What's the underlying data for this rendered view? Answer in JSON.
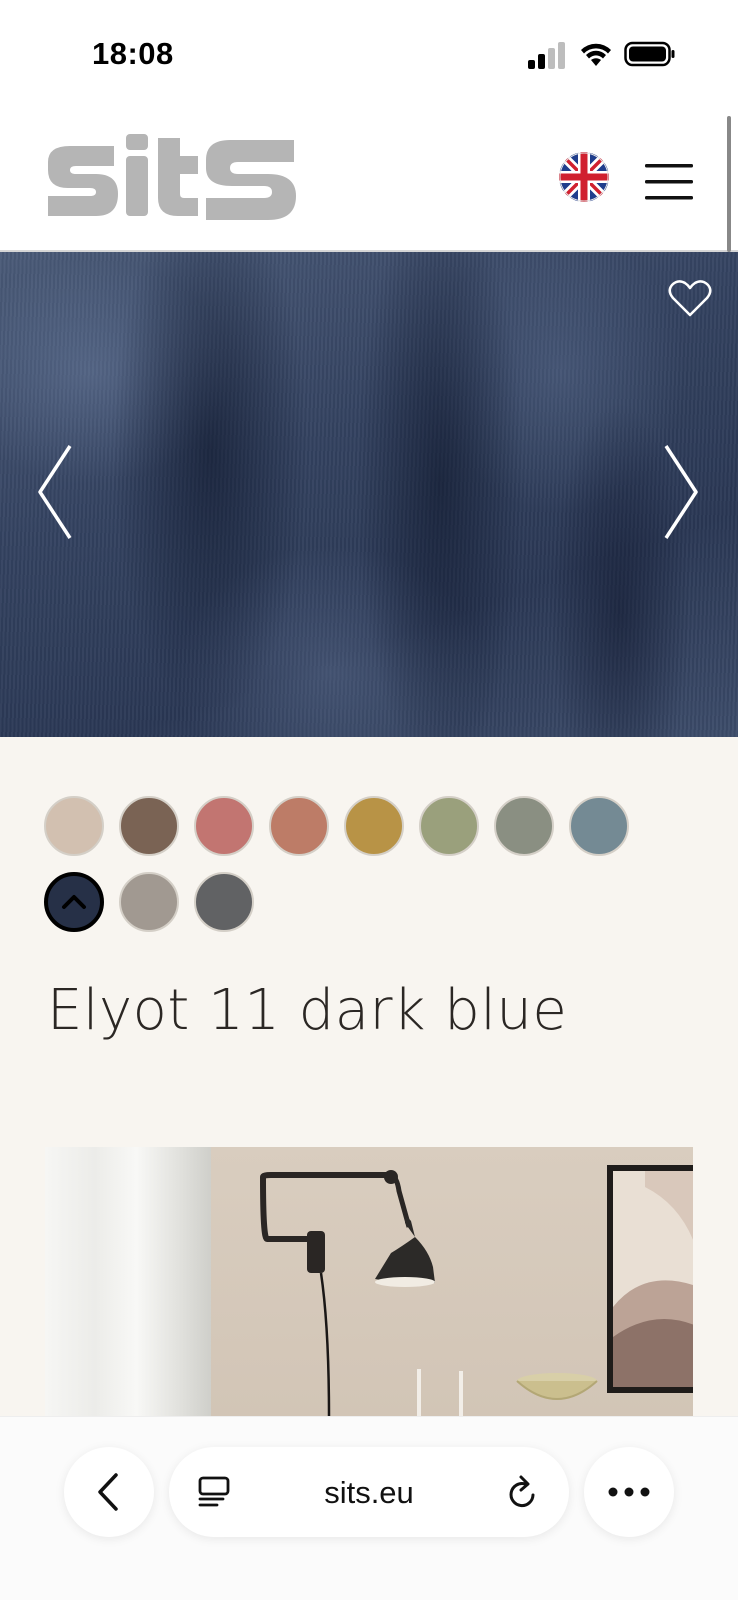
{
  "status_bar": {
    "time": "18:08"
  },
  "header": {
    "logo_text": "sits",
    "language_icon": "uk-flag-icon",
    "menu_icon": "hamburger-menu-icon"
  },
  "hero": {
    "favorite_icon": "heart-outline-icon",
    "prev_icon": "chevron-left-icon",
    "next_icon": "chevron-right-icon"
  },
  "swatches": [
    {
      "color": "#d2c0b0",
      "selected": false
    },
    {
      "color": "#7a6354",
      "selected": false
    },
    {
      "color": "#c27571",
      "selected": false
    },
    {
      "color": "#bd7c67",
      "selected": false
    },
    {
      "color": "#b89346",
      "selected": false
    },
    {
      "color": "#9aa07c",
      "selected": false
    },
    {
      "color": "#8a8f82",
      "selected": false
    },
    {
      "color": "#748a94",
      "selected": false
    },
    {
      "color": "#263047",
      "selected": true
    },
    {
      "color": "#a19991",
      "selected": false
    },
    {
      "color": "#616264",
      "selected": false
    }
  ],
  "product": {
    "title": "Elyot 11 dark blue"
  },
  "browser": {
    "url": "sits.eu",
    "back_icon": "chevron-left-icon",
    "tabs_icon": "tabs-icon",
    "reload_icon": "reload-icon",
    "more_icon": "more-dots-icon"
  }
}
